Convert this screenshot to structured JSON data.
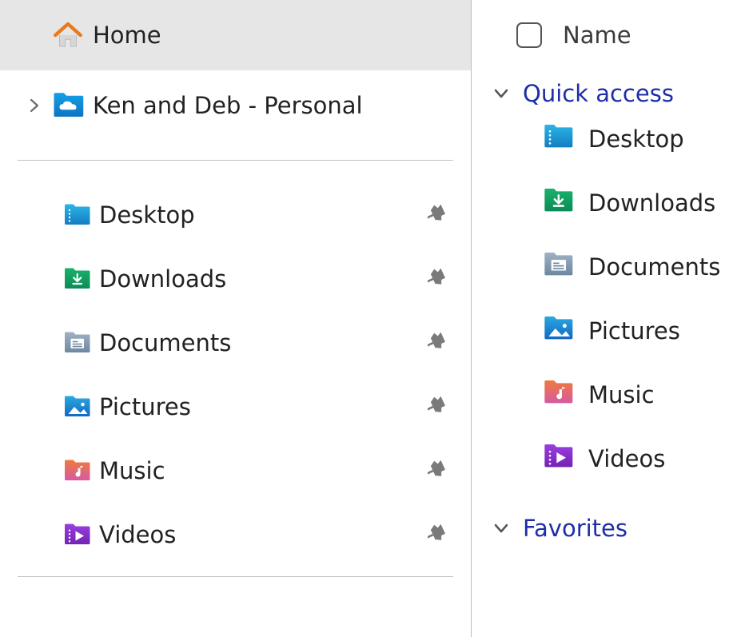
{
  "nav": {
    "home": {
      "label": "Home"
    },
    "onedrive": {
      "label": "Ken and Deb - Personal"
    },
    "pinned": [
      {
        "id": "desktop",
        "label": "Desktop"
      },
      {
        "id": "downloads",
        "label": "Downloads"
      },
      {
        "id": "documents",
        "label": "Documents"
      },
      {
        "id": "pictures",
        "label": "Pictures"
      },
      {
        "id": "music",
        "label": "Music"
      },
      {
        "id": "videos",
        "label": "Videos"
      }
    ]
  },
  "content": {
    "header": {
      "name_column": "Name"
    },
    "groups": {
      "quick_access": {
        "label": "Quick access",
        "items": [
          {
            "id": "desktop",
            "label": "Desktop"
          },
          {
            "id": "downloads",
            "label": "Downloads"
          },
          {
            "id": "documents",
            "label": "Documents"
          },
          {
            "id": "pictures",
            "label": "Pictures"
          },
          {
            "id": "music",
            "label": "Music"
          },
          {
            "id": "videos",
            "label": "Videos"
          }
        ]
      },
      "favorites": {
        "label": "Favorites"
      }
    }
  }
}
